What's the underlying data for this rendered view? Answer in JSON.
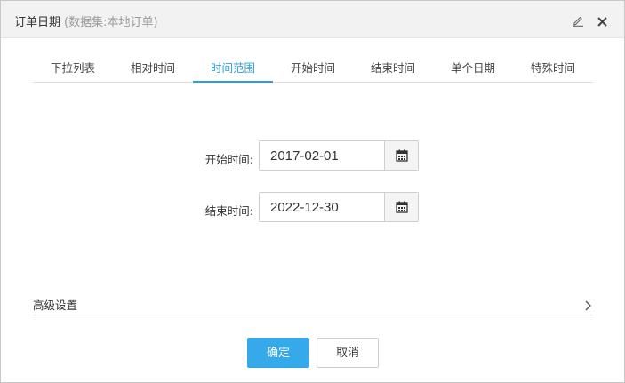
{
  "dialog": {
    "title": "订单日期",
    "subtitle": "(数据集:本地订单)",
    "icons": {
      "edit": "pencil-icon",
      "close": "close-icon"
    }
  },
  "tabs": [
    {
      "label": "下拉列表",
      "active": false
    },
    {
      "label": "相对时间",
      "active": false
    },
    {
      "label": "时间范围",
      "active": true
    },
    {
      "label": "开始时间",
      "active": false
    },
    {
      "label": "结束时间",
      "active": false
    },
    {
      "label": "单个日期",
      "active": false
    },
    {
      "label": "特殊时间",
      "active": false
    }
  ],
  "form": {
    "start": {
      "label": "开始时间:",
      "value": "2017-02-01",
      "icon": "calendar-icon"
    },
    "end": {
      "label": "结束时间:",
      "value": "2022-12-30",
      "icon": "calendar-icon"
    }
  },
  "advanced": {
    "label": "高级设置",
    "icon": "chevron-right-icon"
  },
  "buttons": {
    "ok": "确定",
    "cancel": "取消"
  },
  "colors": {
    "accent": "#2f9fd8",
    "primary_button": "#35a9ea",
    "header_bg": "#f2f2f2"
  }
}
